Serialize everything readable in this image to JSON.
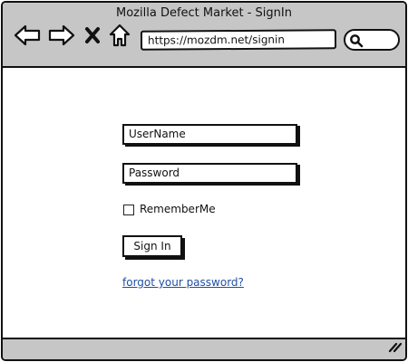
{
  "window": {
    "title": "Mozilla Defect Market - SignIn"
  },
  "toolbar": {
    "back_icon": "arrow-left-icon",
    "forward_icon": "arrow-right-icon",
    "stop_icon": "close-icon",
    "home_icon": "home-icon",
    "search_icon": "search-icon"
  },
  "address_bar": {
    "url": "https://mozdm.net/signin"
  },
  "form": {
    "username_placeholder": "UserName",
    "password_placeholder": "Password",
    "remember_label": "RememberMe",
    "remember_checked": false,
    "signin_label": "Sign In",
    "forgot_link": "forgot your password?"
  },
  "colors": {
    "chrome": "#c6c6c6",
    "link": "#1f4fa6",
    "border": "#111111"
  }
}
